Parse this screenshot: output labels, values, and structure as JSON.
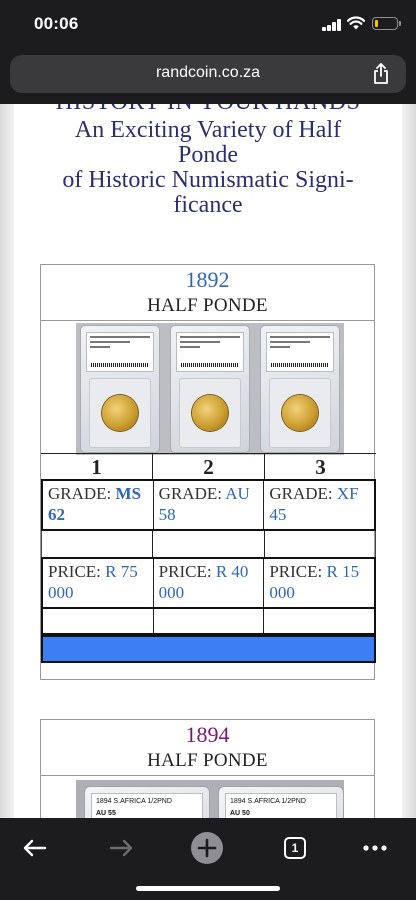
{
  "status_bar": {
    "time": "00:06"
  },
  "browser": {
    "url": "randcoin.co.za",
    "tab_count": "1"
  },
  "page": {
    "heading_cut": "HISTORY IN YOUR HANDS",
    "heading_lines": [
      "An Exciting Variety of Half",
      "Ponde",
      "of Historic Numismatic Signi-",
      "ficance"
    ],
    "card1": {
      "year": "1892",
      "subtitle": "HALF PONDE",
      "slabs": [
        {
          "label": "1892 S.AFRICA 1/2PND",
          "line2": "DOUBLE SHAFT",
          "grade": "MS 62"
        },
        {
          "label": "1892 S.AFRICA 1/2PND",
          "line2": "DOUBLE SHAFT",
          "grade": "AU 58"
        },
        {
          "label": "1892 S.AFRICA 1/2PND",
          "line2": "DOUBLE SHAFT",
          "grade": "XF 45"
        }
      ],
      "columns": [
        "1",
        "2",
        "3"
      ],
      "grade_label": "GRADE:",
      "grades": [
        {
          "a": "MS",
          "b": "62"
        },
        {
          "a": "AU",
          "b": "58"
        },
        {
          "a": "XF",
          "b": "45"
        }
      ],
      "price_label": "PRICE:",
      "prices": [
        {
          "a": "R 75",
          "b": "000"
        },
        {
          "a": "R 40",
          "b": "000"
        },
        {
          "a": "R 15",
          "b": "000"
        }
      ],
      "year_color": "#2f67b5",
      "bar_color": "#3d7ef5"
    },
    "card2": {
      "year": "1894",
      "subtitle": "HALF PONDE",
      "slabs": [
        {
          "label": "1894 S.AFRICA 1/2PND",
          "grade": "AU 55"
        },
        {
          "label": "1894 S.AFRICA 1/2PND",
          "grade": "AU 50"
        }
      ],
      "year_color": "#7a1a6e"
    }
  },
  "toolbar": {
    "icons": [
      "back-arrow",
      "forward-arrow",
      "new-tab-plus",
      "tabs-counter",
      "more-dots"
    ]
  }
}
